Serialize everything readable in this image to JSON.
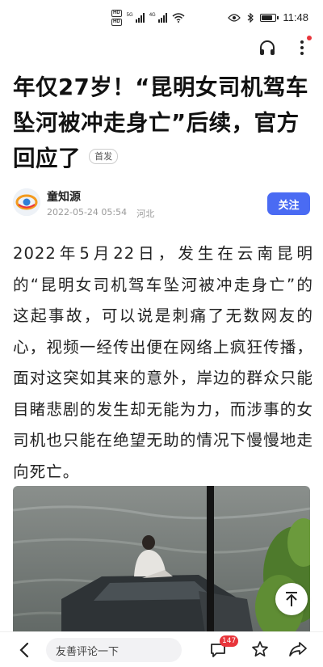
{
  "status_bar": {
    "hd_top": "HD",
    "hd_bottom": "HD",
    "sim1_label": "5G",
    "sim2_label": "4G",
    "time": "11:48",
    "battery_level": 0.85
  },
  "header": {
    "actions": [
      "headphone-icon",
      "more-icon"
    ],
    "has_notification_dot": true
  },
  "article": {
    "title": "年仅27岁！“昆明女司机驾车坠河被冲走身亡”后续，官方回应了",
    "badge": "首发",
    "author": {
      "name": "童知源",
      "timestamp": "2022-05-24 05:54",
      "location": "河北",
      "follow_label": "关注"
    },
    "body": "2022年5月22日，发生在云南昆明的“昆明女司机驾车坠河被冲走身亡”的这起事故，可以说是刺痛了无数网友的心，视频一经传出便在网络上疯狂传播，面对这突如其来的意外，岸边的群众只能目睹悲剧的发生却无能为力，而涉事的女司机也只能在绝望无助的情况下慢慢地走向死亡。",
    "media": {
      "type": "video-thumbnail",
      "scroll_top_icon": "arrow-up-icon"
    }
  },
  "bottom_bar": {
    "comment_placeholder": "友善评论一下",
    "comment_count": "147",
    "icons": [
      "back-icon",
      "comment-icon",
      "star-icon",
      "share-icon"
    ]
  },
  "colors": {
    "accent": "#4a6bf3",
    "badge_red": "#e8353b",
    "text": "#222222",
    "meta_gray": "#999999"
  }
}
